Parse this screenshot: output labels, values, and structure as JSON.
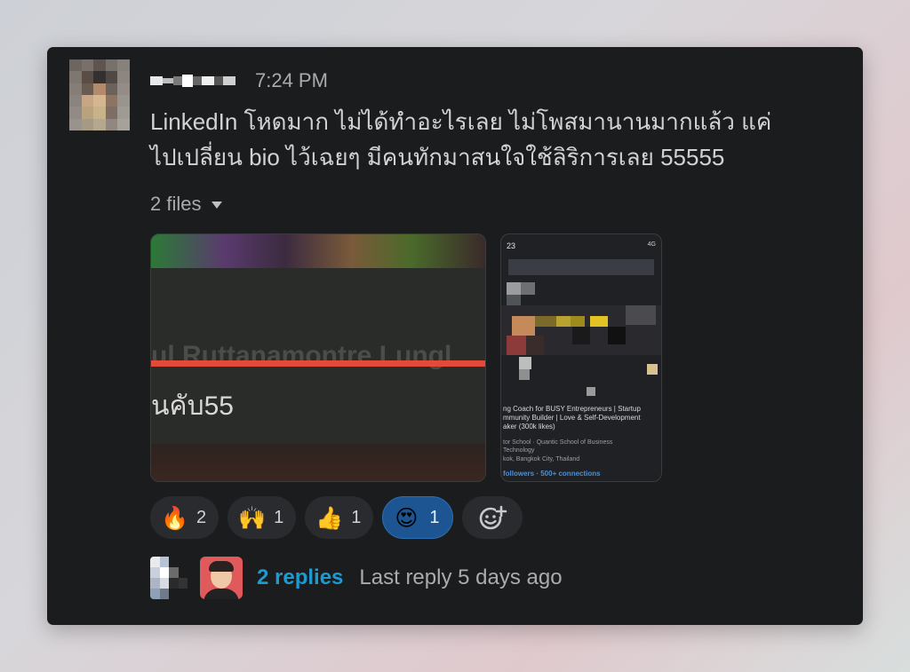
{
  "message": {
    "timestamp": "7:24 PM",
    "text_line1": "LinkedIn โหดมาก ไม่ได้ทำอะไรเลย ไม่โพสมานานมากแล้ว แค่",
    "text_line2": "ไปเปลี่ยน bio ไว้เฉยๆ มีคนทักมาสนใจใช้ลิริการเลย 55555"
  },
  "files": {
    "label": "2 files",
    "file1": {
      "line1": "ul Ruttanamontre Lungl",
      "line2": "นคับ55"
    },
    "file2": {
      "status_time": "23",
      "network": "4G",
      "headline1": "ng Coach for BUSY Entrepreneurs | Startup",
      "headline2": "mmunity Builder | Love & Self-Development",
      "headline3": "aker (300k likes)",
      "edu1": "tor School · Quantic School of Business",
      "edu2": "Technology",
      "location": "kok, Bangkok City, Thailand",
      "connections": "followers · 500+ connections"
    }
  },
  "reactions": [
    {
      "emoji": "🔥",
      "name": "fire",
      "count": "2",
      "active": false
    },
    {
      "emoji": "🙌",
      "name": "raised-hands",
      "count": "1",
      "active": false
    },
    {
      "emoji": "👍",
      "name": "thumbs-up",
      "count": "1",
      "active": false
    },
    {
      "emoji": "😍",
      "name": "heart-eyes",
      "count": "1",
      "active": true
    }
  ],
  "thread": {
    "replies_label": "2 replies",
    "last_reply": "Last reply 5 days ago"
  },
  "colors": {
    "card_bg": "#1b1c1e",
    "link": "#1d9bd1",
    "active_reaction": "#1c5591"
  }
}
